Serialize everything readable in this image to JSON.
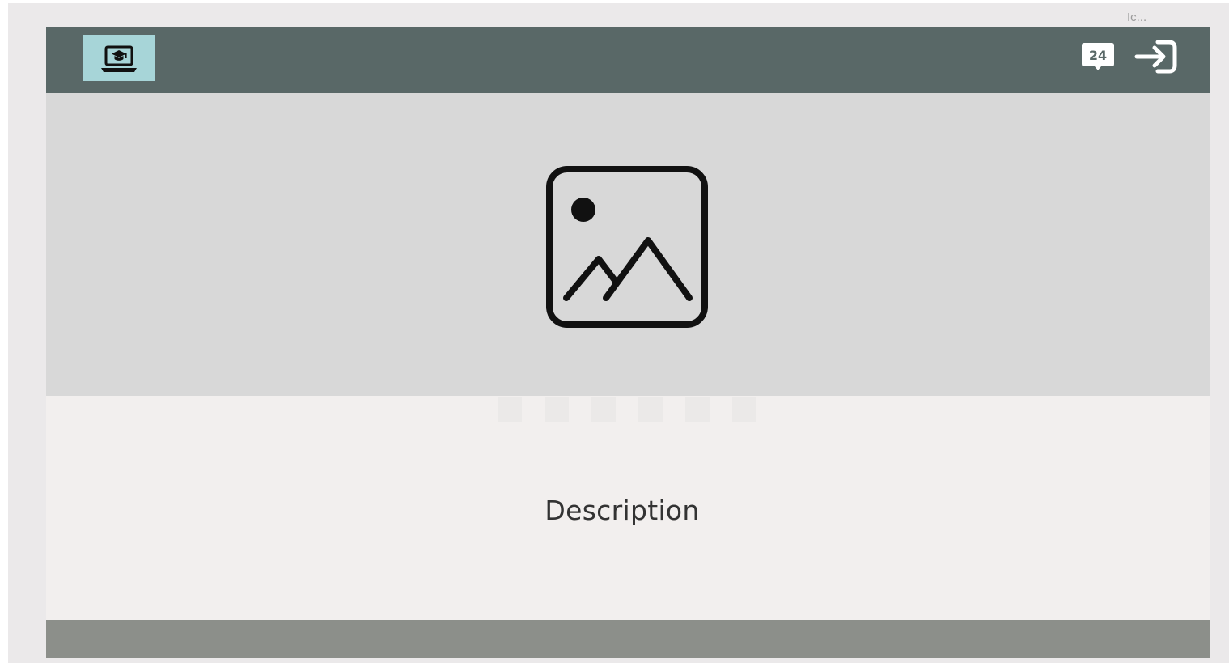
{
  "frame": {
    "label": "Ic..."
  },
  "header": {
    "logo_icon": "laptop-graduation-cap-icon",
    "badge_icon": "24-hours-support-icon",
    "badge_text": "24",
    "login_icon": "sign-in-icon"
  },
  "hero": {
    "icon": "image-placeholder-icon",
    "dot_count": 6
  },
  "content": {
    "description": "Description"
  },
  "colors": {
    "header_bg": "#596867",
    "logo_bg": "#a7d5d8",
    "hero_bg": "#d8d8d8",
    "content_bg": "#f2efee",
    "footer_bg": "#8c8f8a",
    "frame_bg": "#ebe9ea"
  }
}
